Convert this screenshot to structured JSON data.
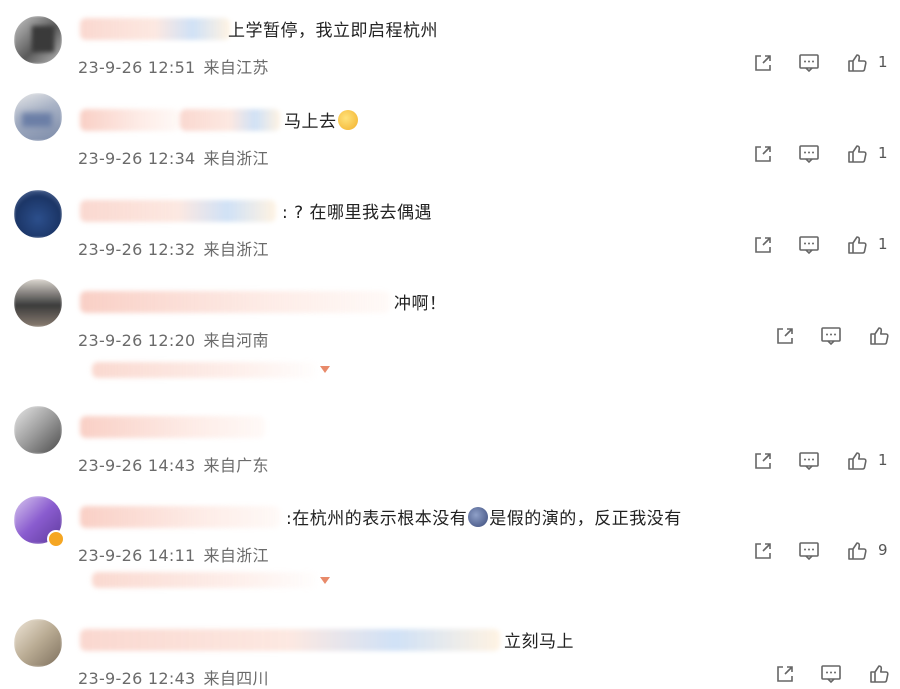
{
  "comments": [
    {
      "text": "上学暂停，我立即启程杭州",
      "date": "23-9-26 12:51",
      "location": "来自江苏",
      "likes": "1"
    },
    {
      "text": "马上去",
      "date": "23-9-26 12:34",
      "location": "来自浙江",
      "likes": "1"
    },
    {
      "text": ": ? 在哪里我去偶遇",
      "date": "23-9-26 12:32",
      "location": "来自浙江",
      "likes": "1"
    },
    {
      "text": "冲啊！",
      "date": "23-9-26 12:20",
      "location": "来自河南",
      "likes": ""
    },
    {
      "text": "",
      "date": "23-9-26 14:43",
      "location": "来自广东",
      "likes": "1"
    },
    {
      "text_a": ":在杭州的表示根本没有",
      "text_b": "是假的演的，反正我没有",
      "date": "23-9-26 14:11",
      "location": "来自浙江",
      "likes": "9"
    },
    {
      "text": "立刻马上",
      "date": "23-9-26 12:43",
      "location": "来自四川",
      "likes": ""
    }
  ],
  "icons": {
    "share": "share-icon",
    "comment": "comment-icon",
    "like": "thumbs-up-icon",
    "emoji": "emoji-icon",
    "verified": "verified-badge-icon",
    "expand": "chevron-down-icon"
  },
  "colors": {
    "meta_text": "#6b6b6b",
    "blur_pink": "#f4a896",
    "verified_orange": "#f5a623"
  }
}
